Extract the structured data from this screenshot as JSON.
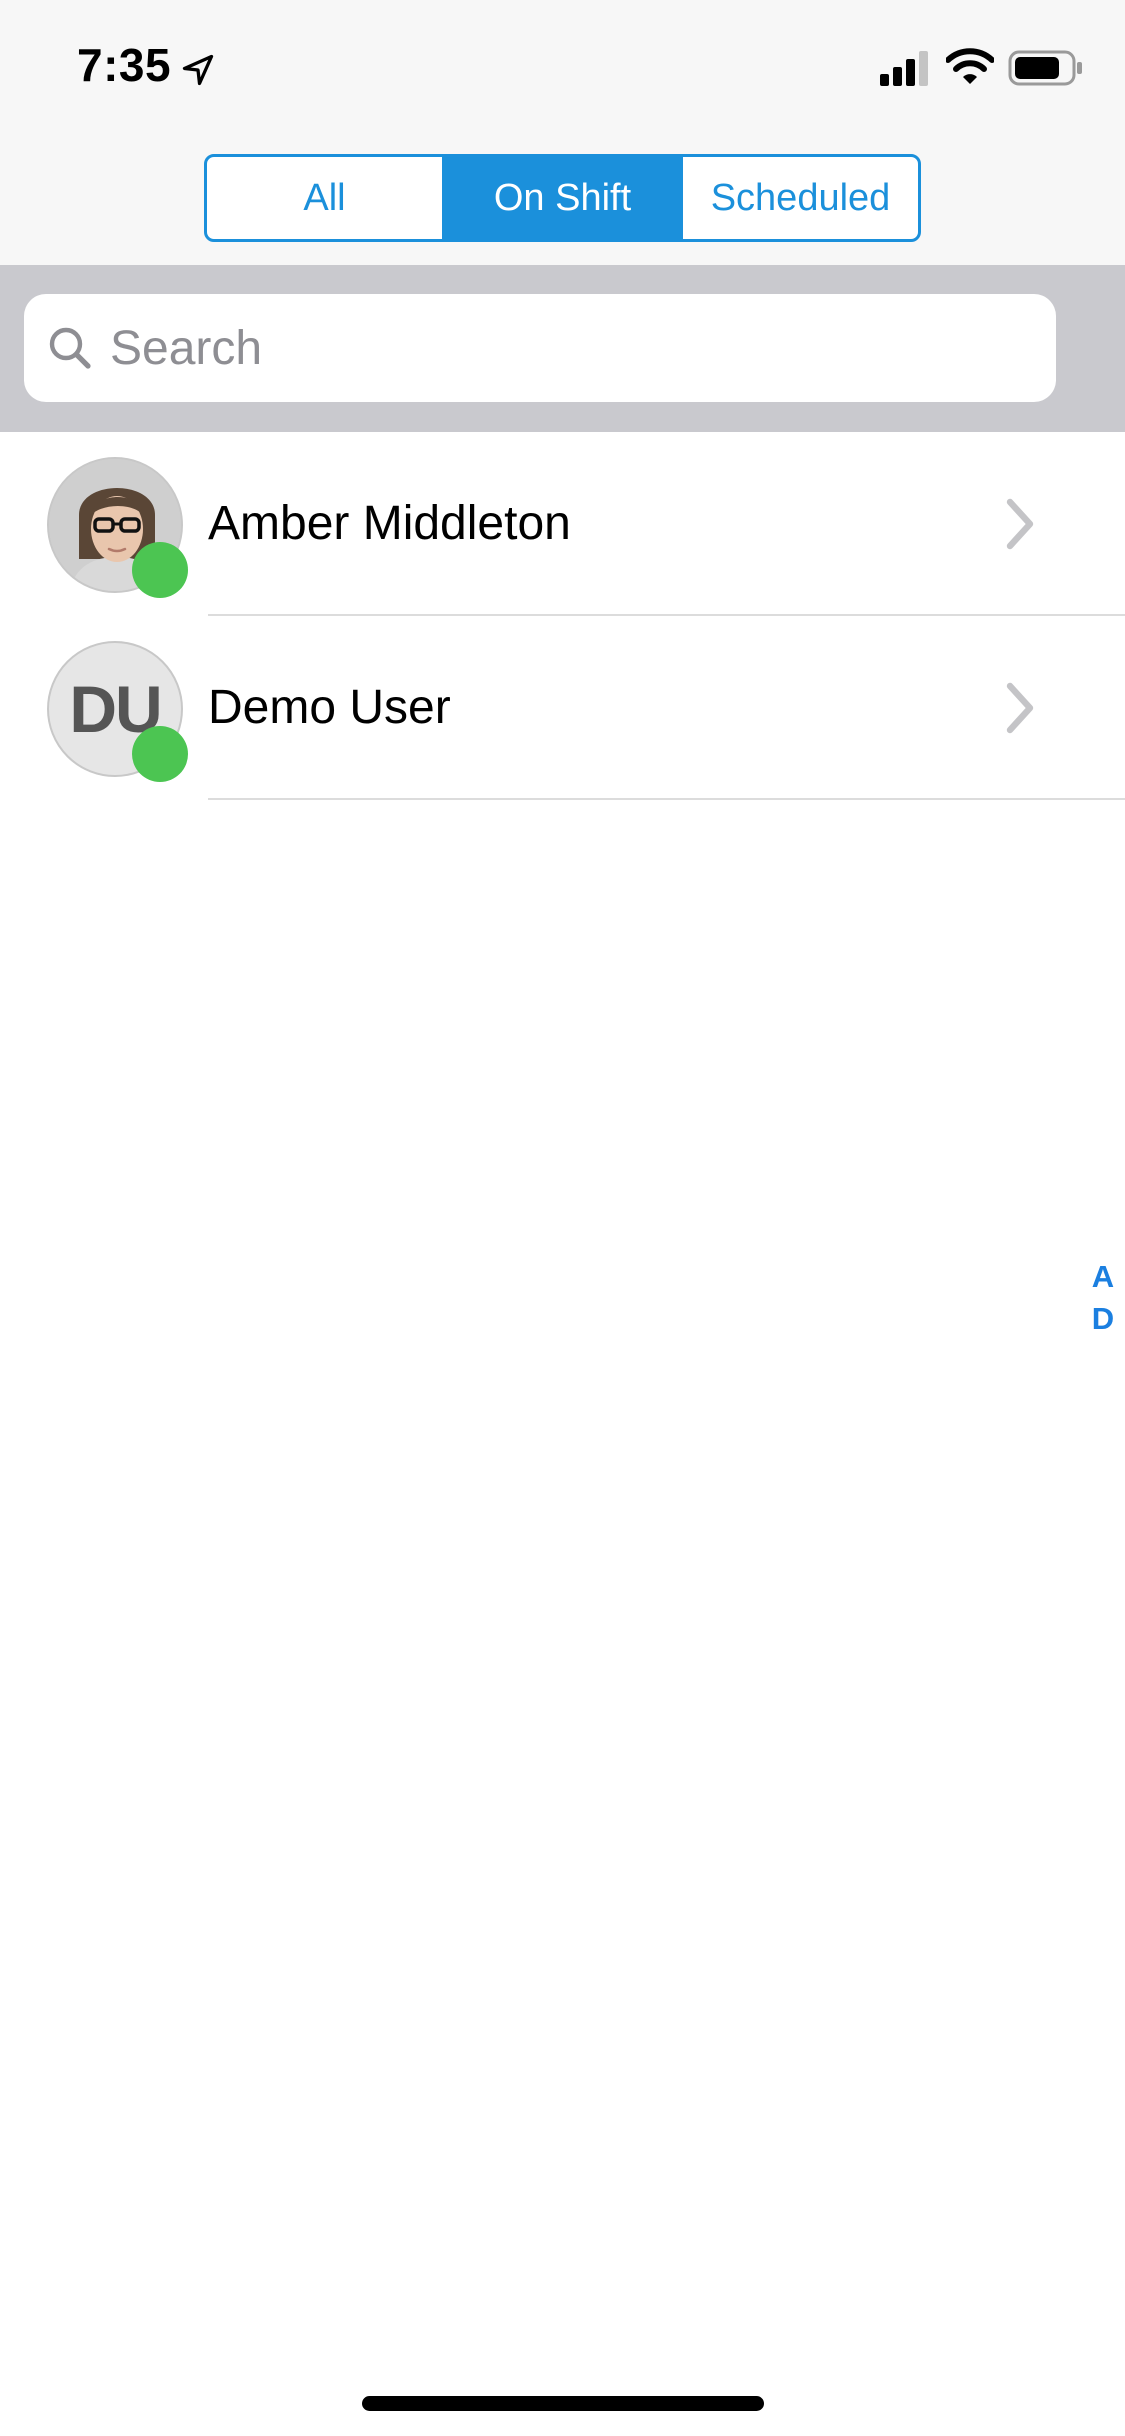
{
  "status_bar": {
    "time": "7:35",
    "icons": [
      "location-arrow-icon",
      "cellular-signal-icon",
      "wifi-icon",
      "battery-icon"
    ]
  },
  "filter": {
    "segments": [
      {
        "label": "All",
        "selected": false
      },
      {
        "label": "On Shift",
        "selected": true
      },
      {
        "label": "Scheduled",
        "selected": false
      }
    ]
  },
  "search": {
    "placeholder": "Search",
    "value": ""
  },
  "contacts": [
    {
      "name": "Amber Middleton",
      "avatar": "photo",
      "status": "online"
    },
    {
      "name": "Demo User",
      "avatar": "initials",
      "initials": "DU",
      "status": "online"
    }
  ],
  "section_index": [
    "A",
    "D"
  ],
  "colors": {
    "accent": "#1b90db",
    "online": "#4cc552",
    "search_bg": "#c9c9ce",
    "index": "#1b7fe0"
  }
}
